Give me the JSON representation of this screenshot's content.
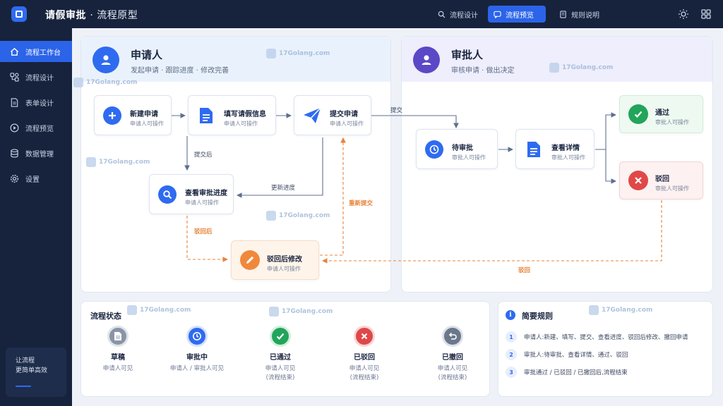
{
  "app": {
    "title": "请假审批",
    "subtitle": "· 流程原型"
  },
  "topnav": [
    {
      "label": "流程设计",
      "icon": "search-icon"
    },
    {
      "label": "流程预览",
      "icon": "chat-icon"
    },
    {
      "label": "规则说明",
      "icon": "document-icon"
    }
  ],
  "sidebar": {
    "items": [
      {
        "label": "流程工作台",
        "icon": "home-icon"
      },
      {
        "label": "流程设计",
        "icon": "flow-icon"
      },
      {
        "label": "表单设计",
        "icon": "form-icon"
      },
      {
        "label": "流程预览",
        "icon": "play-icon"
      },
      {
        "label": "数据管理",
        "icon": "database-icon"
      },
      {
        "label": "设置",
        "icon": "gear-icon"
      }
    ],
    "slogan": [
      "让流程",
      "更简单高效"
    ]
  },
  "applicant": {
    "title": "申请人",
    "subtitle": "发起申请 · 跟踪进度 · 修改完善",
    "nodes": {
      "new": {
        "title": "新建申请",
        "sub": "申请人可操作"
      },
      "fill": {
        "title": "填写请假信息",
        "sub": "申请人可操作"
      },
      "submit": {
        "title": "提交申请",
        "sub": "申请人可操作"
      },
      "progress": {
        "title": "查看审批进度",
        "sub": "申请人可操作"
      },
      "modify": {
        "title": "驳回后修改",
        "sub": "申请人可操作"
      }
    },
    "labels": {
      "after_submit": "提交后",
      "update_progress": "更新进度",
      "after_reject": "驳回后",
      "resubmit": "重新提交"
    }
  },
  "approver": {
    "title": "审批人",
    "subtitle": "审核申请 · 做出决定",
    "nodes": {
      "pending": {
        "title": "待审批",
        "sub": "审批人可操作"
      },
      "detail": {
        "title": "查看详情",
        "sub": "审批人可操作"
      },
      "approve": {
        "title": "通过",
        "sub": "审批人可操作"
      },
      "reject": {
        "title": "驳回",
        "sub": "审批人可操作"
      }
    },
    "labels": {
      "submit": "提交",
      "reject": "驳回"
    }
  },
  "status": {
    "title": "流程状态",
    "items": [
      {
        "name": "草稿",
        "desc1": "申请人可见",
        "desc2": "",
        "color": "#8a94a6"
      },
      {
        "name": "审批中",
        "desc1": "申请人 / 审批人可见",
        "desc2": "",
        "color": "#2f6bf0"
      },
      {
        "name": "已通过",
        "desc1": "申请人可见",
        "desc2": "(流程结束)",
        "color": "#22a45b"
      },
      {
        "name": "已驳回",
        "desc1": "申请人可见",
        "desc2": "(流程结束)",
        "color": "#e04848"
      },
      {
        "name": "已撤回",
        "desc1": "申请人可见",
        "desc2": "(流程结束)",
        "color": "#6b778c"
      }
    ]
  },
  "rules": {
    "title": "简要规则",
    "items": [
      {
        "num": "1",
        "text": "申请人:新建、填写、提交、查看进度、驳回后修改、撤回申请"
      },
      {
        "num": "2",
        "text": "审批人:待审批、查看详情、通过、驳回"
      },
      {
        "num": "3",
        "text": "审批通过 / 已驳回 / 已撤回后,流程结束"
      }
    ]
  },
  "watermark": "17Golang.com",
  "colors": {
    "accent": "#2b64e8",
    "sidebar": "#17233d",
    "green": "#22a45b",
    "red": "#e04848",
    "orange": "#e8833a"
  }
}
